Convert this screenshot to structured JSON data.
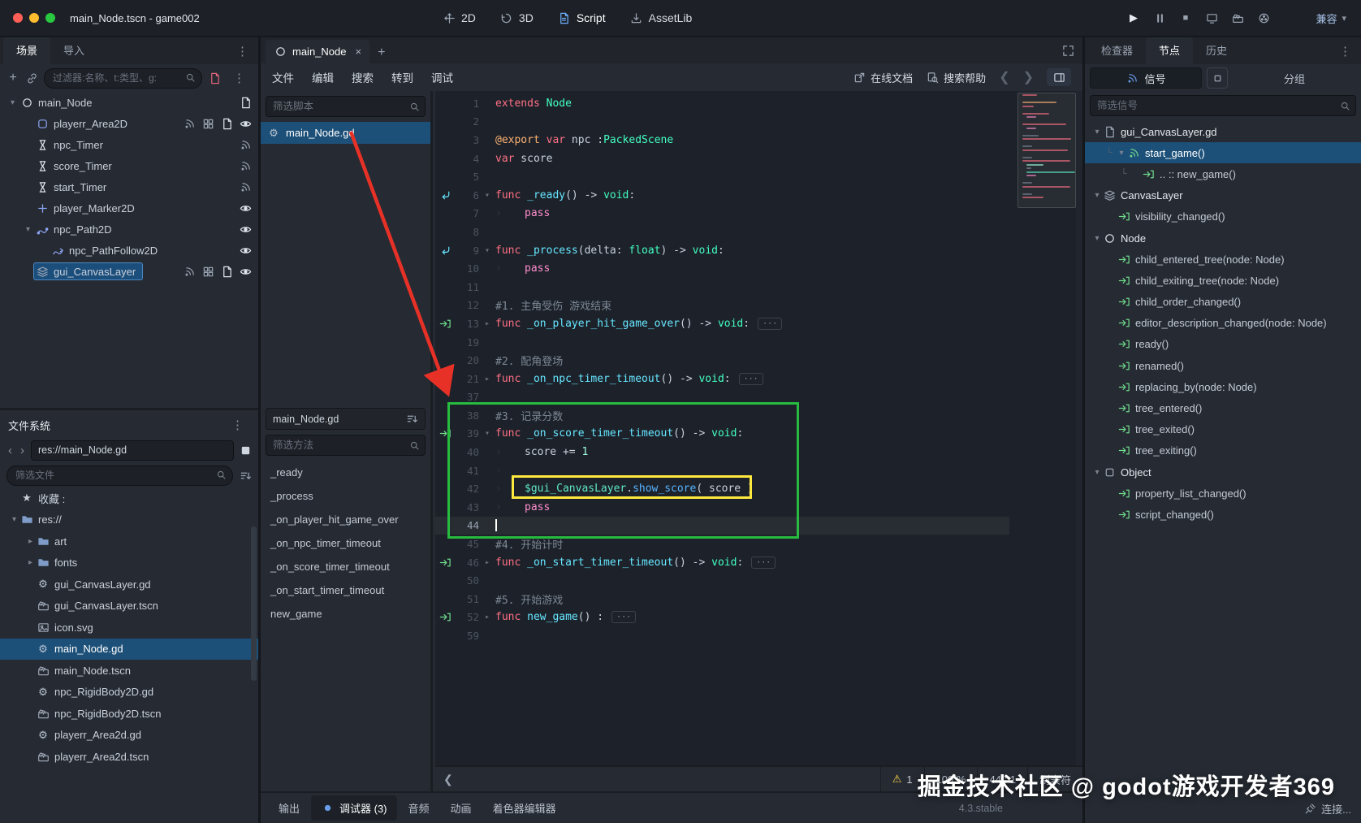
{
  "colors": {
    "accent": "#699ce8",
    "selection": "#1d5078",
    "green_box": "#27bb3f",
    "yellow_box": "#ffe93e",
    "arrow_red": "#e73127"
  },
  "window": {
    "title": "main_Node.tscn - game002"
  },
  "topbar": {
    "workspaces": [
      {
        "label": "2D",
        "icon": "move2d",
        "active": false
      },
      {
        "label": "3D",
        "icon": "rotate3d",
        "active": false
      },
      {
        "label": "Script",
        "icon": "scriptws",
        "active": true
      },
      {
        "label": "AssetLib",
        "icon": "download",
        "active": false
      }
    ],
    "play_icons": [
      "play",
      "pause",
      "stop",
      "play-scene",
      "play-custom",
      "movie-mode"
    ],
    "renderer": "兼容"
  },
  "left": {
    "dock_tabs": [
      {
        "label": "场景",
        "active": true
      },
      {
        "label": "导入",
        "active": false
      }
    ],
    "scene": {
      "filter_placeholder": "过滤器:名称、t:类型、g:",
      "tree": [
        {
          "label": "main_Node",
          "icon": "node",
          "depth": 0,
          "exp": "open",
          "trail": [
            "script"
          ]
        },
        {
          "label": "playerr_Area2D",
          "icon": "area2d",
          "depth": 1,
          "trail": [
            "signal",
            "group",
            "script",
            "eye"
          ]
        },
        {
          "label": "npc_Timer",
          "icon": "timer",
          "depth": 1,
          "trail": [
            "signal"
          ]
        },
        {
          "label": "score_Timer",
          "icon": "timer",
          "depth": 1,
          "trail": [
            "signal"
          ]
        },
        {
          "label": "start_Timer",
          "icon": "timer",
          "depth": 1,
          "trail": [
            "signal"
          ]
        },
        {
          "label": "player_Marker2D",
          "icon": "marker2d",
          "depth": 1,
          "trail": [
            "eye"
          ]
        },
        {
          "label": "npc_Path2D",
          "icon": "path2d",
          "depth": 1,
          "exp": "open",
          "trail": [
            "eye"
          ]
        },
        {
          "label": "npc_PathFollow2D",
          "icon": "pathfollow2d",
          "depth": 2,
          "trail": [
            "eye"
          ]
        },
        {
          "label": "gui_CanvasLayer",
          "icon": "canvaslayer",
          "depth": 1,
          "selected": true,
          "trail": [
            "signal",
            "group",
            "script",
            "eye"
          ]
        }
      ]
    },
    "filesystem": {
      "title": "文件系统",
      "path": "res://main_Node.gd",
      "filter_placeholder": "筛选文件",
      "tree": [
        {
          "label": "收藏 :",
          "icon": "star",
          "depth": 0
        },
        {
          "label": "res://",
          "icon": "folder",
          "depth": 0,
          "exp": "open"
        },
        {
          "label": "art",
          "icon": "folder",
          "depth": 1,
          "exp": "closed"
        },
        {
          "label": "fonts",
          "icon": "folder",
          "depth": 1,
          "exp": "closed"
        },
        {
          "label": "gui_CanvasLayer.gd",
          "icon": "gdscript",
          "depth": 1
        },
        {
          "label": "gui_CanvasLayer.tscn",
          "icon": "scenefile",
          "depth": 1
        },
        {
          "label": "icon.svg",
          "icon": "image",
          "depth": 1
        },
        {
          "label": "main_Node.gd",
          "icon": "gdscript",
          "depth": 1,
          "selected": true
        },
        {
          "label": "main_Node.tscn",
          "icon": "scenefile",
          "depth": 1
        },
        {
          "label": "npc_RigidBody2D.gd",
          "icon": "gdscript",
          "depth": 1
        },
        {
          "label": "npc_RigidBody2D.tscn",
          "icon": "scenefile",
          "depth": 1
        },
        {
          "label": "playerr_Area2d.gd",
          "icon": "gdscript",
          "depth": 1
        },
        {
          "label": "playerr_Area2d.tscn",
          "icon": "scenefile",
          "depth": 1
        }
      ]
    }
  },
  "script_editor": {
    "tab": "main_Node",
    "menus": [
      "文件",
      "编辑",
      "搜索",
      "转到",
      "调试"
    ],
    "online_doc": "在线文档",
    "search_help": "搜索帮助",
    "scripts_filter": "筛选脚本",
    "scripts": [
      {
        "label": "main_Node.gd",
        "selected": true
      }
    ],
    "current_script": "main_Node.gd",
    "methods_filter": "筛选方法",
    "methods": [
      "_ready",
      "_process",
      "_on_player_hit_game_over",
      "_on_npc_timer_timeout",
      "_on_score_timer_timeout",
      "_on_start_timer_timeout",
      "new_game"
    ],
    "status": {
      "warnings": "1",
      "zoom": "100 %",
      "caret": "44 : 1",
      "indent_mode": "制表符"
    },
    "bottom_tabs": [
      {
        "label": "输出",
        "active": false
      },
      {
        "label": "调试器 (3)",
        "active": true,
        "icon": "debugger"
      },
      {
        "label": "音频",
        "active": false
      },
      {
        "label": "动画",
        "active": false
      },
      {
        "label": "着色器编辑器",
        "active": false
      }
    ],
    "version": "4.3.stable"
  },
  "code": {
    "lines": [
      {
        "n": "1",
        "tok": [
          [
            "k",
            "extends"
          ],
          [
            "p",
            " "
          ],
          [
            "t",
            "Node"
          ]
        ]
      },
      {
        "n": "2"
      },
      {
        "n": "3",
        "tok": [
          [
            "a",
            "@export"
          ],
          [
            "p",
            " "
          ],
          [
            "k",
            "var"
          ],
          [
            "p",
            " npc :"
          ],
          [
            "t",
            "PackedScene"
          ]
        ]
      },
      {
        "n": "4",
        "tok": [
          [
            "k",
            "var"
          ],
          [
            "p",
            " score"
          ]
        ]
      },
      {
        "n": "5"
      },
      {
        "n": "6",
        "g": "override",
        "fold": "open",
        "tok": [
          [
            "k",
            "func"
          ],
          [
            "p",
            " "
          ],
          [
            "d",
            "_ready"
          ],
          [
            "p",
            "() -> "
          ],
          [
            "t",
            "void"
          ],
          [
            "p",
            ":"
          ]
        ]
      },
      {
        "n": "7",
        "ind": 1,
        "tok": [
          [
            "c",
            "pass"
          ]
        ]
      },
      {
        "n": "8"
      },
      {
        "n": "9",
        "g": "override",
        "fold": "open",
        "tok": [
          [
            "k",
            "func"
          ],
          [
            "p",
            " "
          ],
          [
            "d",
            "_process"
          ],
          [
            "p",
            "(delta: "
          ],
          [
            "t",
            "float"
          ],
          [
            "p",
            ") -> "
          ],
          [
            "t",
            "void"
          ],
          [
            "p",
            ":"
          ]
        ]
      },
      {
        "n": "10",
        "ind": 1,
        "tok": [
          [
            "c",
            "pass"
          ]
        ]
      },
      {
        "n": "11"
      },
      {
        "n": "12",
        "tok": [
          [
            "m",
            "#1. 主角受伤 游戏结束"
          ]
        ]
      },
      {
        "n": "13",
        "g": "slot",
        "fold": "closed",
        "chip": true,
        "tok": [
          [
            "k",
            "func"
          ],
          [
            "p",
            " "
          ],
          [
            "d",
            "_on_player_hit_game_over"
          ],
          [
            "p",
            "() -> "
          ],
          [
            "t",
            "void"
          ],
          [
            "p",
            ":"
          ]
        ]
      },
      {
        "n": "19"
      },
      {
        "n": "20",
        "tok": [
          [
            "m",
            "#2. 配角登场"
          ]
        ]
      },
      {
        "n": "21",
        "g": "slot",
        "fold": "closed",
        "chip": true,
        "tok": [
          [
            "k",
            "func"
          ],
          [
            "p",
            " "
          ],
          [
            "d",
            "_on_npc_timer_timeout"
          ],
          [
            "p",
            "() -> "
          ],
          [
            "t",
            "void"
          ],
          [
            "p",
            ":"
          ]
        ]
      },
      {
        "n": "37"
      },
      {
        "n": "38",
        "tok": [
          [
            "m",
            "#3. 记录分数"
          ]
        ]
      },
      {
        "n": "39",
        "g": "slot",
        "fold": "open",
        "tok": [
          [
            "k",
            "func"
          ],
          [
            "p",
            " "
          ],
          [
            "d",
            "_on_score_timer_timeout"
          ],
          [
            "p",
            "() -> "
          ],
          [
            "t",
            "void"
          ],
          [
            "p",
            ":"
          ]
        ]
      },
      {
        "n": "40",
        "ind": 1,
        "tok": [
          [
            "p",
            "score += "
          ],
          [
            "nm",
            "1"
          ]
        ]
      },
      {
        "n": "41",
        "ind": 1
      },
      {
        "n": "42",
        "ind": 1,
        "tok": [
          [
            "np",
            "$gui_CanvasLayer"
          ],
          [
            "p",
            "."
          ],
          [
            "f",
            "show_score"
          ],
          [
            "p",
            "( score )"
          ]
        ]
      },
      {
        "n": "43",
        "ind": 1,
        "tok": [
          [
            "c",
            "pass"
          ]
        ]
      },
      {
        "n": "44",
        "cur": true
      },
      {
        "n": "45",
        "tok": [
          [
            "m",
            "#4. 开始计时"
          ]
        ]
      },
      {
        "n": "46",
        "g": "slot",
        "fold": "closed",
        "chip": true,
        "tok": [
          [
            "k",
            "func"
          ],
          [
            "p",
            " "
          ],
          [
            "d",
            "_on_start_timer_timeout"
          ],
          [
            "p",
            "() -> "
          ],
          [
            "t",
            "void"
          ],
          [
            "p",
            ":"
          ]
        ]
      },
      {
        "n": "50"
      },
      {
        "n": "51",
        "tok": [
          [
            "m",
            "#5. 开始游戏"
          ]
        ]
      },
      {
        "n": "52",
        "g": "slot",
        "fold": "closed",
        "chip": true,
        "tok": [
          [
            "k",
            "func"
          ],
          [
            "p",
            " "
          ],
          [
            "d",
            "new_game"
          ],
          [
            "p",
            "() :"
          ]
        ]
      },
      {
        "n": "59"
      }
    ]
  },
  "right": {
    "dock_tabs": [
      {
        "label": "检查器",
        "active": false
      },
      {
        "label": "节点",
        "active": true
      },
      {
        "label": "历史",
        "active": false
      }
    ],
    "signals_tab": "信号",
    "groups_tab": "分组",
    "filter_placeholder": "筛选信号",
    "connect_label": "连接...",
    "tree": [
      {
        "label": "gui_CanvasLayer.gd",
        "icon": "script",
        "depth": 0,
        "exp": "open",
        "cat": true
      },
      {
        "label": "start_game()",
        "icon": "signal",
        "depth": 1,
        "exp": "open",
        "selected": true,
        "conn": true
      },
      {
        "label": ".. :: new_game()",
        "icon": "slot",
        "depth": 2,
        "conn": true
      },
      {
        "label": "CanvasLayer",
        "icon": "canvaslayer",
        "depth": 0,
        "exp": "open",
        "cat": true
      },
      {
        "label": "visibility_changed()",
        "icon": "slot",
        "depth": 1
      },
      {
        "label": "Node",
        "icon": "node",
        "depth": 0,
        "exp": "open",
        "cat": true
      },
      {
        "label": "child_entered_tree(node: Node)",
        "icon": "slot",
        "depth": 1
      },
      {
        "label": "child_exiting_tree(node: Node)",
        "icon": "slot",
        "depth": 1
      },
      {
        "label": "child_order_changed()",
        "icon": "slot",
        "depth": 1
      },
      {
        "label": "editor_description_changed(node: Node)",
        "icon": "slot",
        "depth": 1
      },
      {
        "label": "ready()",
        "icon": "slot",
        "depth": 1
      },
      {
        "label": "renamed()",
        "icon": "slot",
        "depth": 1
      },
      {
        "label": "replacing_by(node: Node)",
        "icon": "slot",
        "depth": 1
      },
      {
        "label": "tree_entered()",
        "icon": "slot",
        "depth": 1
      },
      {
        "label": "tree_exited()",
        "icon": "slot",
        "depth": 1
      },
      {
        "label": "tree_exiting()",
        "icon": "slot",
        "depth": 1
      },
      {
        "label": "Object",
        "icon": "object",
        "depth": 0,
        "exp": "open",
        "cat": true
      },
      {
        "label": "property_list_changed()",
        "icon": "slot",
        "depth": 1
      },
      {
        "label": "script_changed()",
        "icon": "slot",
        "depth": 1
      }
    ]
  },
  "annotations": {
    "watermark": "掘金技术社区 @ godot游戏开发者369"
  }
}
